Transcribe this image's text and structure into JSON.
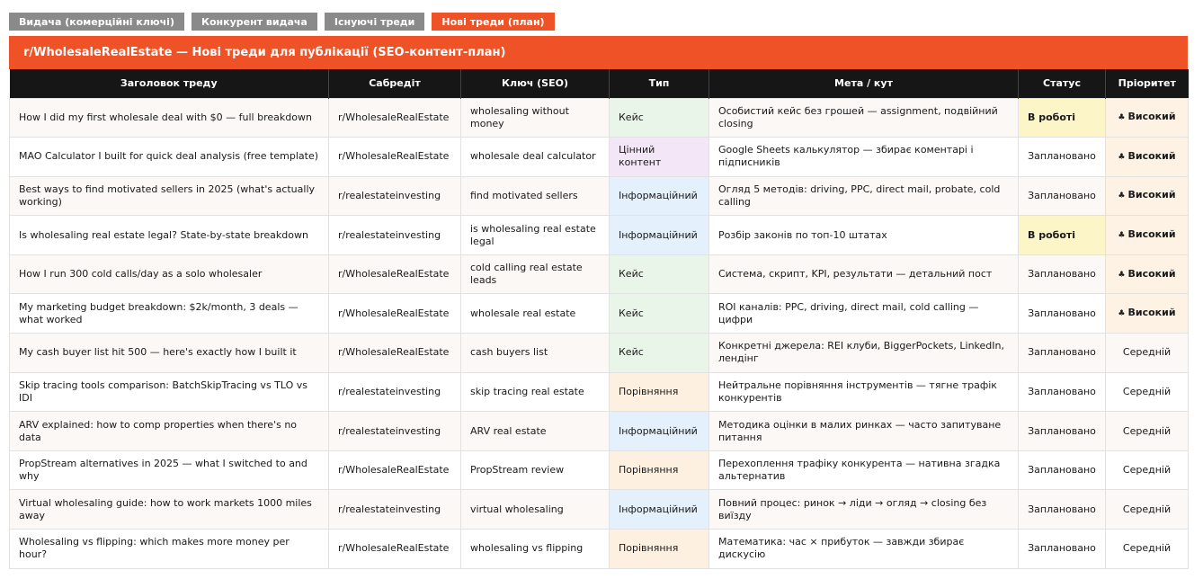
{
  "tabs": [
    {
      "label": "Видача (комерційні ключі)"
    },
    {
      "label": "Конкурент видача"
    },
    {
      "label": "Існуючі треди"
    },
    {
      "label": "Нові треди (план)"
    }
  ],
  "banner": {
    "title": "r/WholesaleRealEstate — Нові треди для публікації (SEO-контент-план)"
  },
  "columns": [
    "Заголовок треду",
    "Сабредіт",
    "Ключ (SEO)",
    "Тип",
    "Мета / кут",
    "Статус",
    "Пріоритет"
  ],
  "rows": [
    {
      "title": "How I did my first wholesale deal with $0 — full breakdown",
      "subreddit": "r/WholesaleRealEstate",
      "keyword": "wholesaling without money",
      "type": "Кейс",
      "goal": "Особистий кейс без грошей — assignment, подвійний closing",
      "status": "В роботі",
      "priority": "Високий"
    },
    {
      "title": "MAO Calculator I built for quick deal analysis (free template)",
      "subreddit": "r/WholesaleRealEstate",
      "keyword": "wholesale deal calculator",
      "type": "Цінний контент",
      "goal": "Google Sheets калькулятор — збирає коментарі і підписників",
      "status": "Заплановано",
      "priority": "Високий"
    },
    {
      "title": "Best ways to find motivated sellers in 2025 (what's actually working)",
      "subreddit": "r/realestateinvesting",
      "keyword": "find motivated sellers",
      "type": "Інформаційний",
      "goal": "Огляд 5 методів: driving, PPC, direct mail, probate, cold calling",
      "status": "Заплановано",
      "priority": "Високий"
    },
    {
      "title": "Is wholesaling real estate legal? State-by-state breakdown",
      "subreddit": "r/realestateinvesting",
      "keyword": "is wholesaling real estate legal",
      "type": "Інформаційний",
      "goal": "Розбір законів по топ-10 штатах",
      "status": "В роботі",
      "priority": "Високий"
    },
    {
      "title": "How I run 300 cold calls/day as a solo wholesaler",
      "subreddit": "r/WholesaleRealEstate",
      "keyword": "cold calling real estate leads",
      "type": "Кейс",
      "goal": "Система, скрипт, KPI, результати — детальний пост",
      "status": "Заплановано",
      "priority": "Високий"
    },
    {
      "title": "My marketing budget breakdown: $2k/month, 3 deals — what worked",
      "subreddit": "r/WholesaleRealEstate",
      "keyword": "wholesale real estate",
      "type": "Кейс",
      "goal": "ROI каналів: PPC, driving, direct mail, cold calling — цифри",
      "status": "Заплановано",
      "priority": "Високий"
    },
    {
      "title": "My cash buyer list hit 500 — here's exactly how I built it",
      "subreddit": "r/WholesaleRealEstate",
      "keyword": "cash buyers list",
      "type": "Кейс",
      "goal": "Конкретні джерела: REI клуби, BiggerPockets, LinkedIn, лендінг",
      "status": "Заплановано",
      "priority": "Середній"
    },
    {
      "title": "Skip tracing tools comparison: BatchSkipTracing vs TLO vs IDI",
      "subreddit": "r/realestateinvesting",
      "keyword": "skip tracing real estate",
      "type": "Порівняння",
      "goal": "Нейтральне порівняння інструментів — тягне трафік конкурентів",
      "status": "Заплановано",
      "priority": "Середній"
    },
    {
      "title": "ARV explained: how to comp properties when there's no data",
      "subreddit": "r/realestateinvesting",
      "keyword": "ARV real estate",
      "type": "Інформаційний",
      "goal": "Методика оцінки в малих ринках — часто запитуване питання",
      "status": "Заплановано",
      "priority": "Середній"
    },
    {
      "title": "PropStream alternatives in 2025 — what I switched to and why",
      "subreddit": "r/WholesaleRealEstate",
      "keyword": "PropStream review",
      "type": "Порівняння",
      "goal": "Перехоплення трафіку конкурента — нативна згадка альтернатив",
      "status": "Заплановано",
      "priority": "Середній"
    },
    {
      "title": "Virtual wholesaling guide: how to work markets 1000 miles away",
      "subreddit": "r/realestateinvesting",
      "keyword": "virtual wholesaling",
      "type": "Інформаційний",
      "goal": "Повний процес: ринок → ліди → огляд → closing без виїзду",
      "status": "Заплановано",
      "priority": "Середній"
    },
    {
      "title": "Wholesaling vs flipping: which makes more money per hour?",
      "subreddit": "r/WholesaleRealEstate",
      "keyword": "wholesaling vs flipping",
      "type": "Порівняння",
      "goal": "Математика: час × прибуток — завжди збирає дискусію",
      "status": "Заплановано",
      "priority": "Середній"
    }
  ]
}
